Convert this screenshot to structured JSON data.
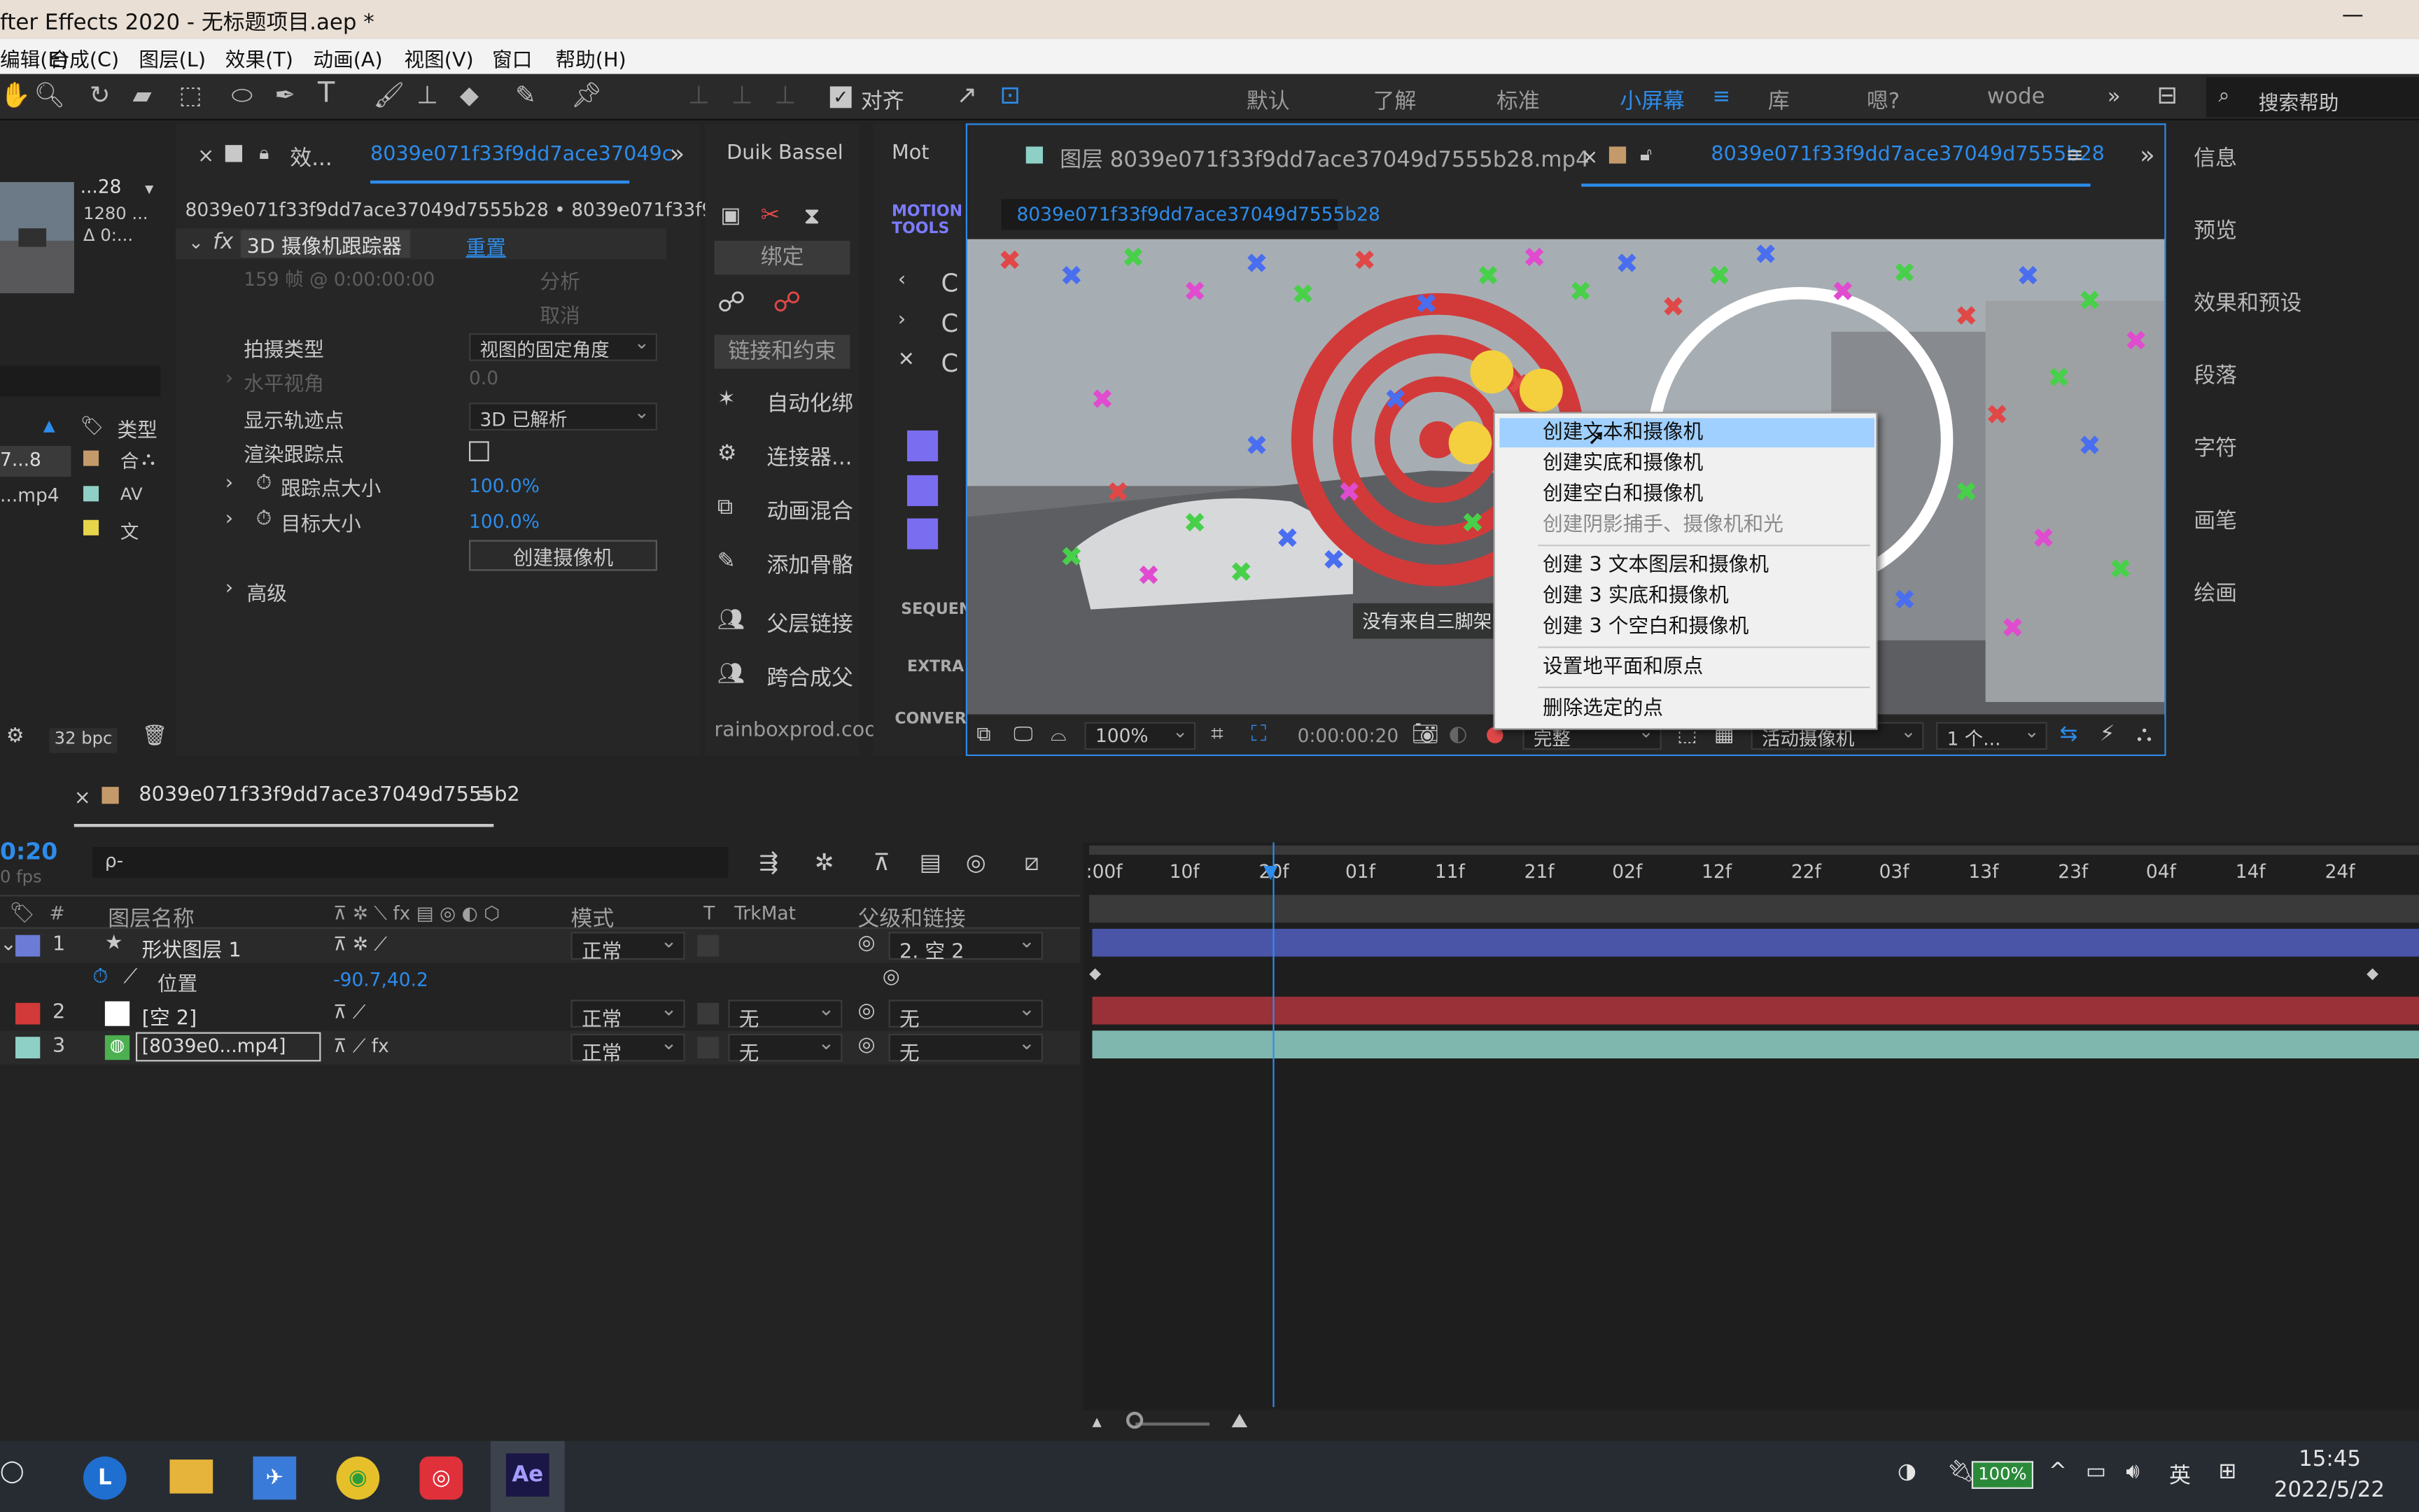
{
  "window": {
    "title": "fter Effects 2020 - 无标题项目.aep *",
    "minimize": "—"
  },
  "menu": [
    "编辑(E)",
    "合成(C)",
    "图层(L)",
    "效果(T)",
    "动画(A)",
    "视图(V)",
    "窗口",
    "帮助(H)"
  ],
  "toolbar": {
    "align_label": "对齐",
    "workspaces": [
      "默认",
      "了解",
      "标准",
      "小屏幕",
      "库",
      "嗯?",
      "wode"
    ],
    "active_workspace": "小屏幕",
    "overflow": "»",
    "search_help": "搜索帮助"
  },
  "project": {
    "thumb_info": [
      "...28",
      "1280 ...",
      "Δ 0:..."
    ],
    "col_type": "类型",
    "items": [
      {
        "name": "7...8",
        "type": "合"
      },
      {
        "name": "...mp4",
        "type": "AV"
      },
      {
        "name": "",
        "type": "文"
      }
    ],
    "bpc": "32 bpc"
  },
  "effects": {
    "tab_label": "效...",
    "tab_comp": "8039e071f33f9dd7ace37049c",
    "breadcrumb": "8039e071f33f9dd7ace37049d7555b28 • 8039e071f33f9dd7a",
    "fx": "fx",
    "effect_name": "3D 摄像机跟踪器",
    "reset": "重置",
    "frames_info": "159 帧 @ 0:00:00:00",
    "analyze": "分析",
    "cancel": "取消",
    "shoot_type_label": "拍摄类型",
    "shoot_type_value": "视图的固定角度",
    "hfov_label": "水平视角",
    "hfov_value": "0.0",
    "show_tracks_label": "显示轨迹点",
    "show_tracks_value": "3D 已解析",
    "render_tracks_label": "渲染跟踪点",
    "track_size_label": "跟踪点大小",
    "track_size_value": "100.0%",
    "target_size_label": "目标大小",
    "target_size_value": "100.0%",
    "create_camera": "创建摄像机",
    "advanced": "高级"
  },
  "duik": {
    "tab": "Duik Bassel",
    "bind": "绑定",
    "links": "链接和约束",
    "items": [
      "自动化绑",
      "连接器...",
      "动画混合",
      "添加骨骼",
      "父层链接",
      "跨合成父"
    ],
    "footer": "rainboxprod.coo"
  },
  "motion": {
    "tab": "Mot",
    "logo": "MOTION TOOLS",
    "labels": [
      "SEQUEN",
      "EXTRA",
      "CONVER"
    ]
  },
  "viewer": {
    "tab_layer": "图层 8039e071f33f9dd7ace37049d7555b28.mp4",
    "tab_comp": "8039e071f33f9dd7ace37049d7555b28",
    "comp_chip": "8039e071f33f9dd7ace37049d7555b28",
    "overlay_text": "没有来自三脚架",
    "zoom": "100%",
    "timecode": "0:00:00:20",
    "quality": "完整",
    "camera": "活动摄像机",
    "views": "1 个..."
  },
  "context_menu": [
    "创建文本和摄像机",
    "创建实底和摄像机",
    "创建空白和摄像机",
    "创建阴影捕手、摄像机和光",
    "创建 3 文本图层和摄像机",
    "创建 3 实底和摄像机",
    "创建 3 个空白和摄像机",
    "设置地平面和原点",
    "删除选定的点"
  ],
  "right_panel": [
    "信息",
    "预览",
    "效果和预设",
    "段落",
    "字符",
    "画笔",
    "绘画"
  ],
  "timeline": {
    "tab": "8039e071f33f9dd7ace37049d7555b2",
    "timecode": "0:20",
    "fps": "0 fps",
    "search_placeholder": "ρ-",
    "col_num": "#",
    "col_name": "图层名称",
    "col_mode": "模式",
    "col_t": "T",
    "col_trkmat": "TrkMat",
    "col_parent": "父级和链接",
    "ruler": [
      ":00f",
      "10f",
      "20f",
      "01f",
      "11f",
      "21f",
      "02f",
      "12f",
      "22f",
      "03f",
      "13f",
      "23f",
      "04f",
      "14f",
      "24f"
    ],
    "layers": [
      {
        "num": "1",
        "name": "形状图层 1",
        "mode": "正常",
        "trkmat": "",
        "parent": "2. 空 2",
        "color": "#6b7bd6"
      },
      {
        "num": "",
        "name": "位置",
        "mode": "",
        "trkmat": "",
        "parent": "",
        "value": "-90.7,40.2",
        "color": ""
      },
      {
        "num": "2",
        "name": "[空 2]",
        "mode": "正常",
        "trkmat": "无",
        "parent": "无",
        "color": "#d23a3a"
      },
      {
        "num": "3",
        "name": "[8039e0...mp4]",
        "mode": "正常",
        "trkmat": "无",
        "parent": "无",
        "color": "#8fd0c6"
      }
    ]
  },
  "taskbar": {
    "battery": "100%",
    "ime": "英",
    "time": "15:45",
    "date": "2022/5/22",
    "ae": "Ae"
  }
}
